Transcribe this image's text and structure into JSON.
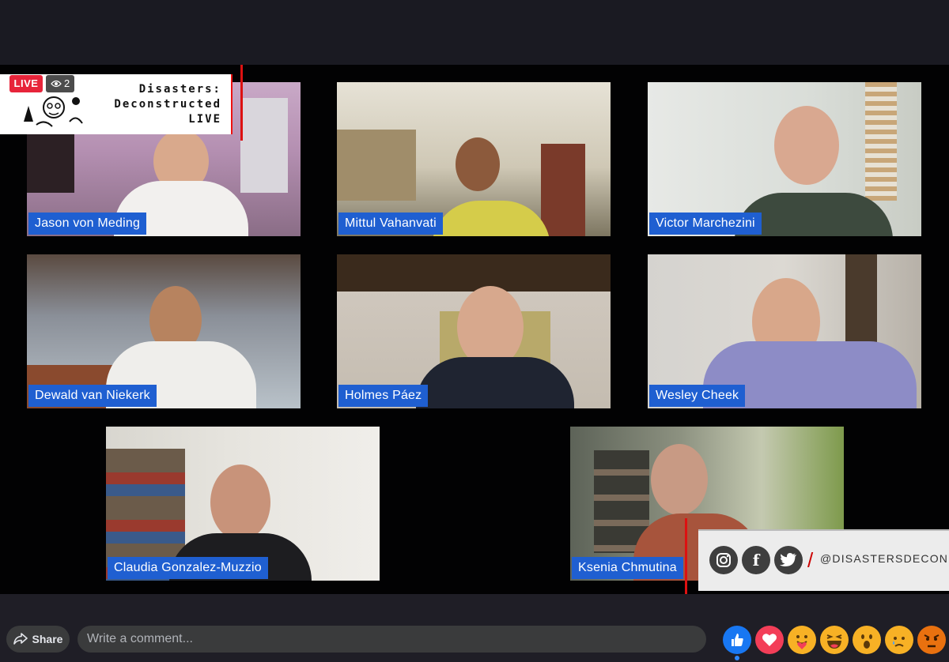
{
  "stream": {
    "live_label": "LIVE",
    "viewer_count": "2",
    "title": "Disasters:\nDeconstructed\nLIVE"
  },
  "participants": [
    {
      "name": "Jason von Meding"
    },
    {
      "name": "Mittul Vahanvati"
    },
    {
      "name": "Victor Marchezini"
    },
    {
      "name": "Dewald van Niekerk"
    },
    {
      "name": "Holmes Páez"
    },
    {
      "name": "Wesley Cheek"
    },
    {
      "name": "Claudia Gonzalez-Muzzio"
    },
    {
      "name": "Ksenia Chmutina"
    }
  ],
  "social": {
    "handle": "@DISASTERSDECON",
    "icons": [
      "instagram-icon",
      "facebook-icon",
      "twitter-icon"
    ]
  },
  "bottom_bar": {
    "share_label": "Share",
    "comment_placeholder": "Write a comment...",
    "reactions": [
      "like",
      "love",
      "care",
      "haha",
      "wow",
      "sad",
      "angry"
    ]
  },
  "colors": {
    "name_tag": "#1f5fd1",
    "live_red": "#e7243a",
    "accent_line": "#dd1111"
  }
}
